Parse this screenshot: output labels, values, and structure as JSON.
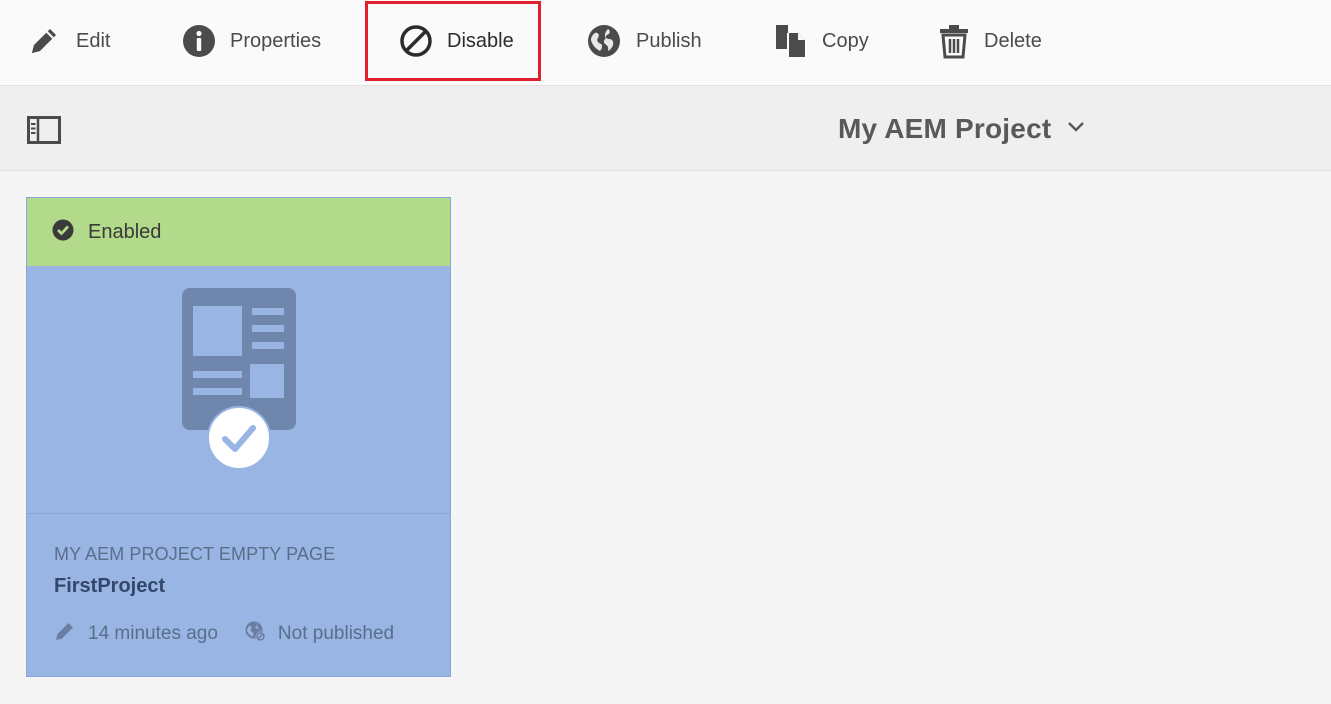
{
  "toolbar": {
    "edit_label": "Edit",
    "properties_label": "Properties",
    "disable_label": "Disable",
    "publish_label": "Publish",
    "copy_label": "Copy",
    "delete_label": "Delete",
    "highlight_color": "#e0202c"
  },
  "header": {
    "project_title": "My AEM Project"
  },
  "card": {
    "status": "Enabled",
    "status_color": "#b3d98b",
    "selected_color": "#98b5e3",
    "type": "MY AEM PROJECT EMPTY PAGE",
    "name": "FirstProject",
    "modified": "14 minutes ago",
    "publish_status": "Not published"
  },
  "icons": [
    "pencil-icon",
    "info-icon",
    "disable-icon",
    "globe-icon",
    "copy-icon",
    "trash-icon",
    "rail-toggle-icon",
    "chevron-down-icon",
    "check-circle-icon",
    "page-template-icon",
    "selected-check-icon",
    "globe-unpublished-icon"
  ]
}
